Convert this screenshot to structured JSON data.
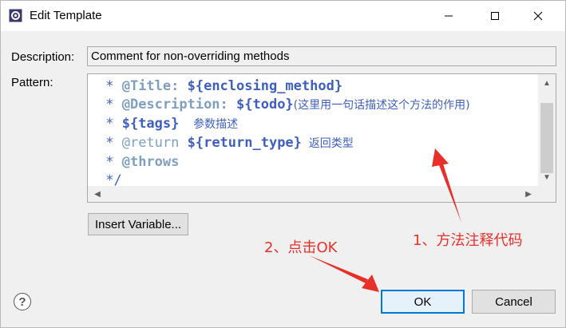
{
  "window": {
    "title": "Edit Template",
    "icons": {
      "app": "gear-icon",
      "minimize": "minimize-icon",
      "maximize": "maximize-icon",
      "close": "close-icon"
    }
  },
  "form": {
    "description_label": "Description:",
    "description_value": "Comment for non-overriding methods",
    "pattern_label": "Pattern:",
    "pattern_lines": {
      "l1_star": " * ",
      "l1_tag": "@Title:",
      "l1_var": " ${enclosing_method}",
      "l2_star": " * ",
      "l2_tag": "@Description:",
      "l2_var": " ${todo}",
      "l2_cn": "(这里用一句话描述这个方法的作用)",
      "l3_star": " * ",
      "l3_var": "${tags}",
      "l3_cn": "    参数描述",
      "l4_star": " * ",
      "l4_tag": "@return",
      "l4_var": " ${return_type}",
      "l4_cn": "  返回类型",
      "l5_star": " * ",
      "l5_tag": "@throws",
      "l6": " */"
    },
    "insert_variable_label": "Insert Variable..."
  },
  "footer": {
    "help_label": "?",
    "ok_label": "OK",
    "cancel_label": "Cancel"
  },
  "annotations": {
    "note1": "1、方法注释代码",
    "note2": "2、点击OK",
    "color": "#e8302a"
  }
}
